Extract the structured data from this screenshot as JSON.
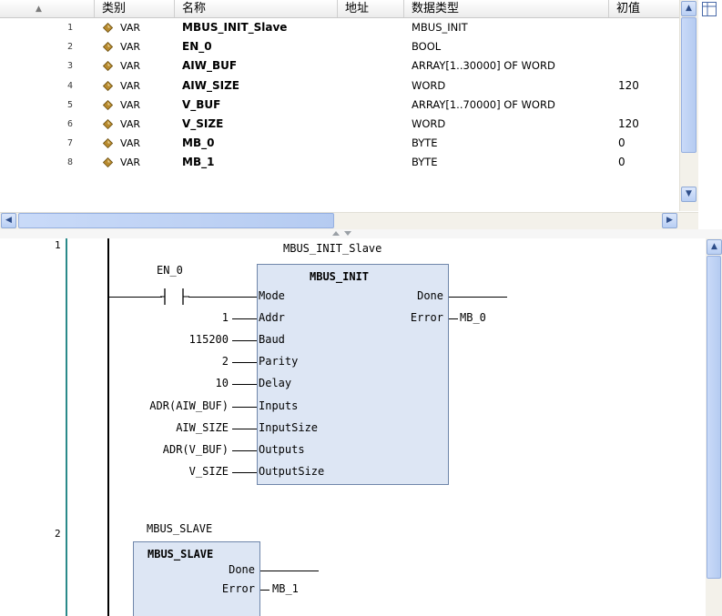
{
  "table": {
    "headers": {
      "sort": "▲",
      "category": "类别",
      "name": "名称",
      "address": "地址",
      "data_type": "数据类型",
      "initial": "初值"
    },
    "rows": [
      {
        "num": "1",
        "kind": "VAR",
        "name": "MBUS_INIT_Slave",
        "type": "MBUS_INIT",
        "init": ""
      },
      {
        "num": "2",
        "kind": "VAR",
        "name": "EN_0",
        "type": "BOOL",
        "init": ""
      },
      {
        "num": "3",
        "kind": "VAR",
        "name": "AIW_BUF",
        "type": "ARRAY[1..30000] OF WORD",
        "init": ""
      },
      {
        "num": "4",
        "kind": "VAR",
        "name": "AIW_SIZE",
        "type": "WORD",
        "init": "120"
      },
      {
        "num": "5",
        "kind": "VAR",
        "name": "V_BUF",
        "type": "ARRAY[1..70000] OF WORD",
        "init": ""
      },
      {
        "num": "6",
        "kind": "VAR",
        "name": "V_SIZE",
        "type": "WORD",
        "init": "120"
      },
      {
        "num": "7",
        "kind": "VAR",
        "name": "MB_0",
        "type": "BYTE",
        "init": "0"
      },
      {
        "num": "8",
        "kind": "VAR",
        "name": "MB_1",
        "type": "BYTE",
        "init": "0"
      }
    ],
    "var_icon_color": "#b88a2e"
  },
  "ladder": {
    "network1": {
      "number": "1",
      "instance": "MBUS_INIT_Slave",
      "block_type": "MBUS_INIT",
      "contact_var": "EN_0",
      "inputs": [
        {
          "pin": "Mode",
          "value": ""
        },
        {
          "pin": "Addr",
          "value": "1"
        },
        {
          "pin": "Baud",
          "value": "115200"
        },
        {
          "pin": "Parity",
          "value": "2"
        },
        {
          "pin": "Delay",
          "value": "10"
        },
        {
          "pin": "Inputs",
          "value": "ADR(AIW_BUF)"
        },
        {
          "pin": "InputSize",
          "value": "AIW_SIZE"
        },
        {
          "pin": "Outputs",
          "value": "ADR(V_BUF)"
        },
        {
          "pin": "OutputSize",
          "value": "V_SIZE"
        }
      ],
      "outputs": [
        {
          "pin": "Done",
          "value": ""
        },
        {
          "pin": "Error",
          "value": "MB_0"
        }
      ]
    },
    "network2": {
      "number": "2",
      "instance": "MBUS_SLAVE",
      "block_type": "MBUS_SLAVE",
      "outputs": [
        {
          "pin": "Done",
          "value": ""
        },
        {
          "pin": "Error",
          "value": "MB_1"
        }
      ]
    },
    "block_fill": "#dde6f4",
    "network_marker_color": "#2a8a8a"
  },
  "icons": [
    "sort-arrow-icon",
    "var-diamond-icon",
    "scroll-up-icon",
    "scroll-down-icon",
    "scroll-left-icon",
    "scroll-right-icon",
    "table-layout-icon",
    "splitter-arrows-icon",
    "contact-icon"
  ]
}
